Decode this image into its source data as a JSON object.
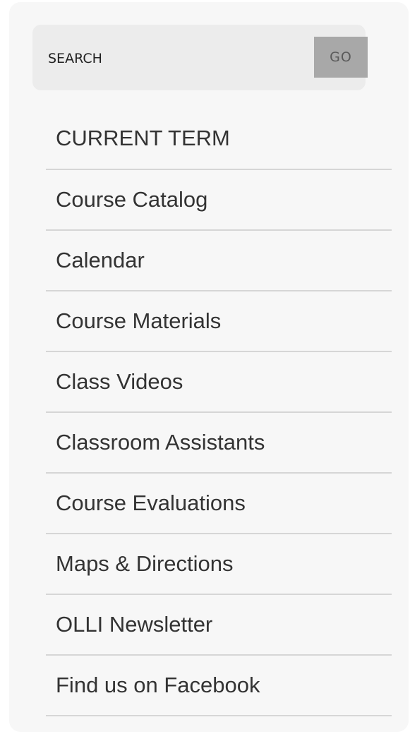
{
  "search": {
    "placeholder": "SEARCH",
    "go_label": "GO"
  },
  "nav": {
    "items": [
      {
        "label": "CURRENT TERM"
      },
      {
        "label": "Course Catalog"
      },
      {
        "label": "Calendar"
      },
      {
        "label": "Course Materials"
      },
      {
        "label": "Class Videos"
      },
      {
        "label": "Classroom Assistants"
      },
      {
        "label": "Course Evaluations"
      },
      {
        "label": "Maps & Directions"
      },
      {
        "label": "OLLI Newsletter"
      },
      {
        "label": "Find us on Facebook"
      }
    ]
  }
}
